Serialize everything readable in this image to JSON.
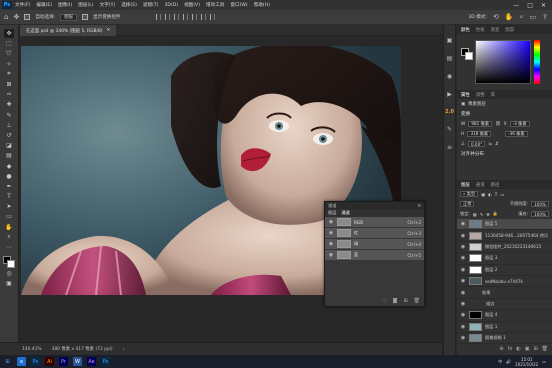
{
  "app": {
    "logo": "Ps",
    "menu": [
      "文件(F)",
      "编辑(E)",
      "图像(I)",
      "图层(L)",
      "文字(Y)",
      "选择(S)",
      "滤镜(T)",
      "3D(D)",
      "视图(V)",
      "增效工具",
      "窗口(W)",
      "帮助(H)"
    ],
    "window_controls": [
      "—",
      "□",
      "✕"
    ]
  },
  "options_bar": {
    "auto_select_label": "自动选择:",
    "auto_select_value": "图层",
    "transform_label": "显示变换控件",
    "mode_3d": "3D 模式:"
  },
  "document": {
    "tab_title": "在这里.psd @ 140% (图层 5, RGB/8)",
    "tab_close": "✕"
  },
  "status": {
    "zoom": "140.41%",
    "doc_info": "380 像素 x 417 像素 (72 ppi)",
    "arrow": "›"
  },
  "collapsed_panel_icons": [
    "▣",
    "▤",
    "◉",
    "▶",
    "2.0",
    "✎",
    "≡"
  ],
  "color_panel": {
    "tabs": [
      "颜色",
      "色板",
      "渐变",
      "图案"
    ]
  },
  "properties": {
    "tabs": [
      "属性",
      "调整",
      "库"
    ],
    "layer_type": "像素图层",
    "transform_title": "变换",
    "w_label": "W",
    "w_value": "981 像素",
    "x_label": "X",
    "x_value": "-3 像素",
    "h_label": "H",
    "h_value": "318 像素",
    "y_value": "-36 像素",
    "angle_value": "0.00°",
    "align_title": "对齐并分布"
  },
  "layers_panel": {
    "tabs": [
      "图层",
      "通道",
      "路径"
    ],
    "blend_mode": "正常",
    "opacity_label": "不透明度:",
    "opacity_value": "100%",
    "lock_label": "锁定:",
    "fill_label": "填充:",
    "fill_value": "100%",
    "layers": [
      {
        "name": "图层 5",
        "selected": true
      },
      {
        "name": "1130458-946...20075464 拷贝",
        "selected": false
      },
      {
        "name": "微信图片_20210223140615",
        "selected": false
      },
      {
        "name": "图层 3",
        "selected": false
      },
      {
        "name": "图层 2",
        "selected": false
      },
      {
        "name": "sedNoobu e7447k",
        "selected": false
      },
      {
        "name": "效果",
        "selected": false
      },
      {
        "name": "描边",
        "selected": false
      },
      {
        "name": "图层 4",
        "selected": false
      },
      {
        "name": "图层 1",
        "selected": false
      },
      {
        "name": "图像规格 1",
        "selected": false
      }
    ],
    "footer_icons": [
      "⊕",
      "fx",
      "◐",
      "▣",
      "⊞",
      "🗑"
    ]
  },
  "channels_panel": {
    "header": "通道",
    "tabs": [
      "图层",
      "通道"
    ],
    "channels": [
      {
        "name": "RGB",
        "shortcut": "Ctrl+2"
      },
      {
        "name": "红",
        "shortcut": "Ctrl+3"
      },
      {
        "name": "绿",
        "shortcut": "Ctrl+4"
      },
      {
        "name": "蓝",
        "shortcut": "Ctrl+5"
      }
    ]
  },
  "taskbar": {
    "start_icon": "⊞",
    "apps": [
      "e",
      "Ps",
      "Ai",
      "Pr",
      "W",
      "Ae",
      "Ps"
    ],
    "time": "15:01",
    "date": "2021/10/22",
    "lang": "中"
  }
}
